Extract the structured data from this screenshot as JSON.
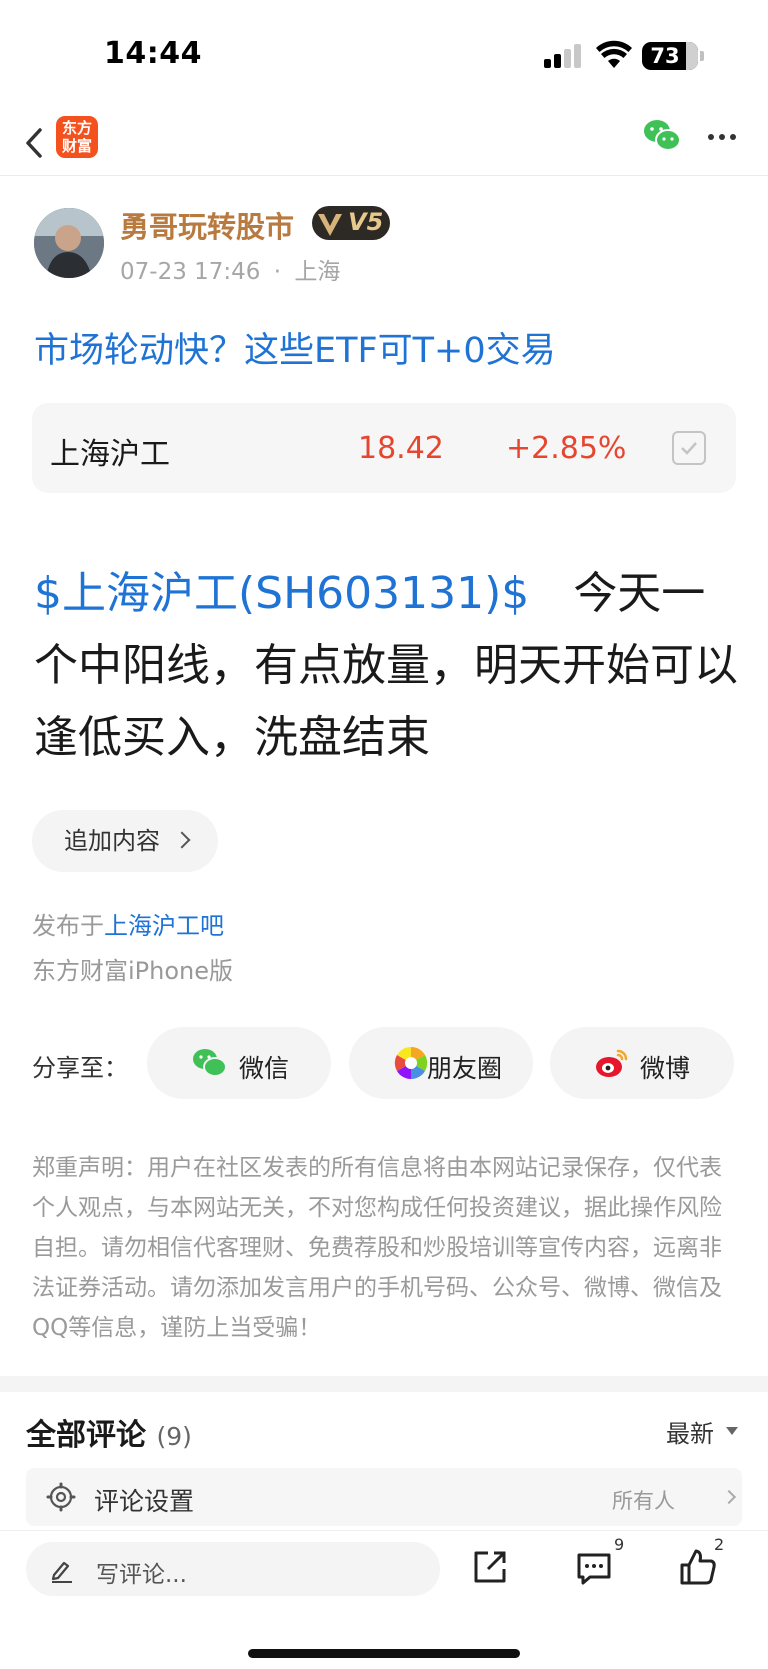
{
  "status_bar": {
    "time": "14:44",
    "battery": "73"
  },
  "nav": {
    "logo_line1": "东方",
    "logo_line2": "财富"
  },
  "author": {
    "name": "勇哥玩转股市",
    "vip_level": "V5",
    "post_time": "07-23 17:46",
    "location": "上海",
    "meta_separator": "·"
  },
  "post": {
    "title": "市场轮动快？这些ETF可T+0交易",
    "stock_card": {
      "name": "上海沪工",
      "price": "18.42",
      "change": "+2.85%"
    },
    "stock_tag": "$上海沪工(SH603131)$",
    "body_text": "今天一个中阳线，有点放量，明天开始可以逢低买入，洗盘结束",
    "add_content_label": "追加内容",
    "published_prefix": "发布于",
    "published_board": "上海沪工吧",
    "client": "东方财富iPhone版"
  },
  "share": {
    "label": "分享至：",
    "wechat": "微信",
    "moments": "朋友圈",
    "weibo": "微博"
  },
  "disclaimer": "郑重声明：用户在社区发表的所有信息将由本网站记录保存，仅代表个人观点，与本网站无关，不对您构成任何投资建议，据此操作风险自担。请勿相信代客理财、免费荐股和炒股培训等宣传内容，远离非法证券活动。请勿添加发言用户的手机号码、公众号、微博、微信及QQ等信息，谨防上当受骗！",
  "comments": {
    "title": "全部评论",
    "count": "(9)",
    "sort": "最新",
    "settings_label": "评论设置",
    "settings_value": "所有人"
  },
  "bottom_bar": {
    "write_placeholder": "写评论...",
    "comment_count": "9",
    "like_count": "2"
  }
}
